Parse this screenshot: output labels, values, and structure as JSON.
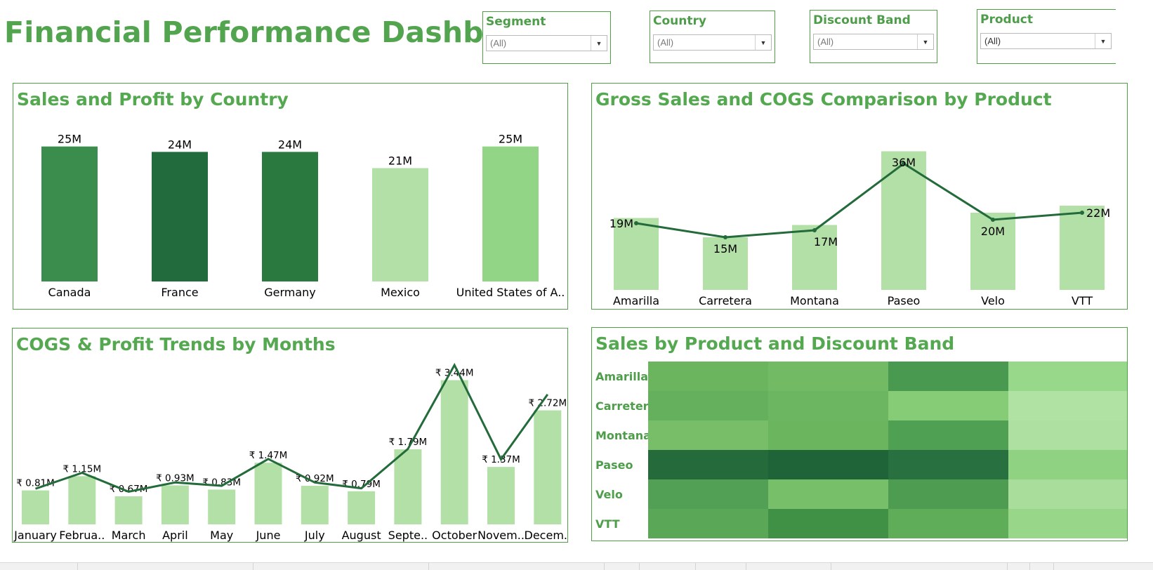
{
  "header": {
    "title": "Financial Performance Dashboard"
  },
  "filters": [
    {
      "label": "Segment",
      "value": "(All)"
    },
    {
      "label": "Country",
      "value": "(All)"
    },
    {
      "label": "Discount Band",
      "value": "(All)"
    },
    {
      "label": "Product",
      "value": "(All)"
    }
  ],
  "colors": {
    "accent": "#54a850",
    "border": "#4f9f45",
    "light_bar": "#b3e0a7",
    "line": "#236b3b"
  },
  "panels": {
    "country": {
      "title": "Sales and Profit by Country"
    },
    "product": {
      "title": "Gross Sales and COGS Comparison by Product"
    },
    "months": {
      "title": "COGS & Profit Trends by Months"
    },
    "heatmap": {
      "title": "Sales by Product and Discount Band"
    }
  },
  "chart_data": [
    {
      "type": "bar",
      "title": "Sales and Profit by Country",
      "categories": [
        "Canada",
        "France",
        "Germany",
        "Mexico",
        "United States of A.."
      ],
      "values": [
        25,
        24,
        24,
        21,
        25
      ],
      "labels": [
        "25M",
        "24M",
        "24M",
        "21M",
        "25M"
      ],
      "colors": [
        "#3b8d4d",
        "#226b3d",
        "#2a7a40",
        "#b3e0a7",
        "#93d587"
      ],
      "ylim": [
        0,
        26
      ]
    },
    {
      "type": "bar",
      "title": "Gross Sales and COGS Comparison by Product",
      "categories": [
        "Amarilla",
        "Carretera",
        "Montana",
        "Paseo",
        "Velo",
        "VTT"
      ],
      "series": [
        {
          "type": "bar",
          "values": [
            20.5,
            15.0,
            18.5,
            39.5,
            22.0,
            24.0
          ]
        },
        {
          "type": "line",
          "values": [
            19,
            15,
            17,
            36,
            20,
            22
          ],
          "labels": [
            "19M",
            "15M",
            "17M",
            "36M",
            "20M",
            "22M"
          ]
        }
      ],
      "ylim": [
        0,
        40
      ]
    },
    {
      "type": "bar",
      "title": "COGS & Profit Trends by Months",
      "categories": [
        "January",
        "Februa..",
        "March",
        "April",
        "May",
        "June",
        "July",
        "August",
        "Septe..",
        "October",
        "Novem..",
        "Decem.."
      ],
      "series": [
        {
          "type": "bar",
          "values": [
            0.81,
            1.15,
            0.67,
            0.93,
            0.83,
            1.47,
            0.92,
            0.79,
            1.79,
            3.44,
            1.37,
            2.72
          ],
          "labels": [
            "₹ 0.81M",
            "₹ 1.15M",
            "₹ 0.67M",
            "₹ 0.93M",
            "₹ 0.83M",
            "₹ 1.47M",
            "₹ 0.92M",
            "₹ 0.79M",
            "₹ 1.79M",
            "₹ 3.44M",
            "₹ 1.37M",
            "₹ 2.72M"
          ]
        },
        {
          "type": "line",
          "values": [
            0.85,
            1.23,
            0.78,
            1.0,
            0.92,
            1.56,
            1.0,
            0.86,
            1.8,
            3.8,
            1.55,
            3.1
          ]
        }
      ],
      "ylim": [
        0,
        3.6
      ]
    },
    {
      "type": "heatmap",
      "title": "Sales by Product and Discount Band",
      "rows": [
        "Amarilla",
        "Carretera",
        "Montana",
        "Paseo",
        "Velo",
        "VTT"
      ],
      "columns": [
        "",
        "",
        "",
        ""
      ],
      "colors": [
        [
          "#6ab55e",
          "#72ba64",
          "#4a9951",
          "#98d88a"
        ],
        [
          "#64b05c",
          "#6cb662",
          "#86cb76",
          "#b0e2a4"
        ],
        [
          "#78be69",
          "#6ab55e",
          "#50a053",
          "#aee0a2"
        ],
        [
          "#246a3b",
          "#1f6438",
          "#287040",
          "#8fd281"
        ],
        [
          "#52a055",
          "#78bf6a",
          "#4d9c52",
          "#a8dd9c"
        ],
        [
          "#5aa757",
          "#409046",
          "#5fac59",
          "#98d78a"
        ]
      ]
    }
  ]
}
